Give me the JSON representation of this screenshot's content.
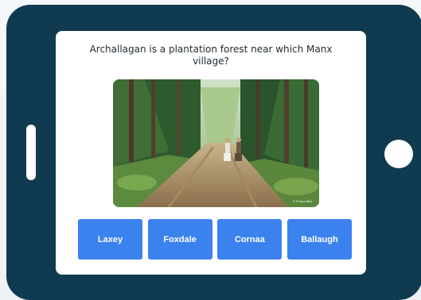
{
  "quiz": {
    "question": "Archallagan is a plantation forest near which Manx village?",
    "image_credit": "© Emma Blair",
    "answers": [
      {
        "label": "Laxey"
      },
      {
        "label": "Foxdale"
      },
      {
        "label": "Cornaa"
      },
      {
        "label": "Ballaugh"
      }
    ]
  },
  "colors": {
    "tablet_frame": "#0f3a4f",
    "answer_button": "#3b82ef",
    "screen": "#ffffff"
  }
}
